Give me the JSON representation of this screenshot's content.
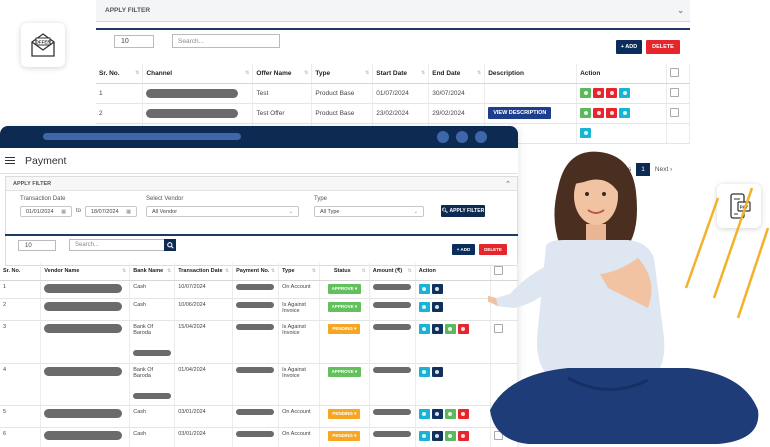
{
  "back": {
    "filter_label": "APPLY FILTER",
    "page_size": "10",
    "search_placeholder": "Search...",
    "add_label": "+ ADD",
    "delete_label": "DELETE",
    "columns": [
      "Sr. No.",
      "Channel",
      "Offer Name",
      "Type",
      "Start Date",
      "End Date",
      "Description",
      "Action"
    ],
    "rows": [
      {
        "sr": "1",
        "offer": "Test",
        "type": "Product Base",
        "start": "01/07/2024",
        "end": "30/07/2024",
        "desc": ""
      },
      {
        "sr": "2",
        "offer": "Test Offer",
        "type": "Product Base",
        "start": "23/02/2024",
        "end": "29/02/2024",
        "desc": "VIEW DESCRIPTION"
      }
    ],
    "pagination": {
      "prev": "Previous",
      "current": "1",
      "next": "Next"
    }
  },
  "front": {
    "title": "Payment",
    "filter_label": "APPLY FILTER",
    "transaction_date_label": "Transaction Date",
    "date_from": "01/01/2024",
    "to_label": "to",
    "date_to": "18/07/2024",
    "vendor_label": "Select Vendor",
    "vendor_value": "All Vendor",
    "type_label": "Type",
    "type_value": "All Type",
    "apply_filter_btn": "APPLY FILTER",
    "page_size": "10",
    "search_placeholder": "Search...",
    "add_label": "+ ADD",
    "delete_label": "DELETE",
    "columns": [
      "Sr. No.",
      "Vendor Name",
      "Bank Name",
      "Transaction Date",
      "Payment No.",
      "Type",
      "Status",
      "Amount (₹)",
      "Action"
    ],
    "rows": [
      {
        "sr": "1",
        "bank": "Cash",
        "date": "10/07/2024",
        "type": "On Account",
        "status": "APPROVE",
        "pending": false
      },
      {
        "sr": "2",
        "bank": "Cash",
        "date": "10/06/2024",
        "type": "Is Against Invoice",
        "status": "APPROVE",
        "pending": false
      },
      {
        "sr": "3",
        "bank": "Bank Of Baroda",
        "date": "15/04/2024",
        "type": "Is Against Invoice",
        "status": "PENDING",
        "pending": true
      },
      {
        "sr": "4",
        "bank": "Bank Of Baroda",
        "date": "01/04/2024",
        "type": "Is Against Invoice",
        "status": "APPROVE",
        "pending": false
      },
      {
        "sr": "5",
        "bank": "Cash",
        "date": "03/01/2024",
        "type": "On Account",
        "status": "PENDING",
        "pending": true
      },
      {
        "sr": "6",
        "bank": "Cash",
        "date": "03/01/2024",
        "type": "On Account",
        "status": "PENDING",
        "pending": true
      }
    ]
  },
  "icons": {
    "offer_card": "offer-envelope-icon",
    "pay_card": "pay-phone-icon",
    "offer_text": "OFFER",
    "pay_text": "PAY"
  },
  "colors": {
    "navy": "#0d2a52",
    "approve": "#62c15b",
    "pending": "#f6a623",
    "delete": "#e5262c",
    "view": "#18b4d4",
    "edit": "#5cb85c"
  }
}
